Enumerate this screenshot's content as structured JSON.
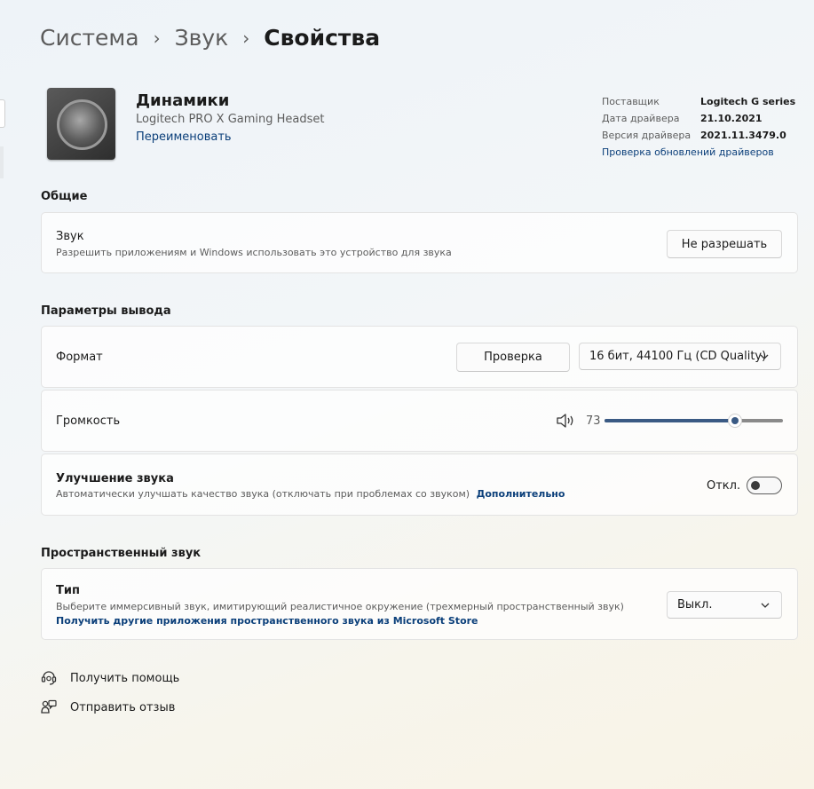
{
  "breadcrumb": [
    "Система",
    "Звук",
    "Свойства"
  ],
  "device": {
    "name": "Динамики",
    "model": "Logitech PRO X Gaming Headset",
    "rename": "Переименовать"
  },
  "driver_info": {
    "rows": [
      {
        "key": "Поставщик",
        "value": "Logitech G series"
      },
      {
        "key": "Дата драйвера",
        "value": "21.10.2021"
      },
      {
        "key": "Версия драйвера",
        "value": "2021.11.3479.0"
      }
    ],
    "update_link": "Проверка обновлений драйверов"
  },
  "general": {
    "title": "Общие",
    "audio": {
      "title": "Звук",
      "subtitle": "Разрешить приложениям и Windows использовать это устройство для звука",
      "button": "Не разрешать"
    }
  },
  "output": {
    "title": "Параметры вывода",
    "format": {
      "label": "Формат",
      "test_button": "Проверка",
      "selected": "16 бит, 44100 Гц (CD Quality)"
    },
    "volume": {
      "label": "Громкость",
      "value": "73",
      "level": 0.73
    },
    "enhance": {
      "title": "Улучшение звука",
      "subtitle": "Автоматически улучшать качество звука (отключать при проблемах со звуком)",
      "more_link": "Дополнительно",
      "state": "Откл."
    }
  },
  "spatial": {
    "title": "Пространственный звук",
    "type": {
      "title": "Тип",
      "subtitle": "Выберите иммерсивный звук, имитирующий реалистичное окружение (трехмерный пространственный звук)",
      "store_link": "Получить другие приложения пространственного звука из Microsoft Store",
      "selected": "Выкл."
    }
  },
  "footer": {
    "help": "Получить помощь",
    "feedback": "Отправить отзыв"
  },
  "colors": {
    "accent": "#3a5a84",
    "link": "#0b3f7a"
  }
}
